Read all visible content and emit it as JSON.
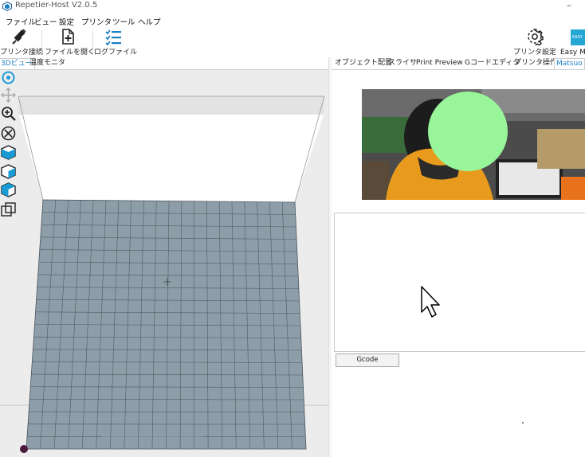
{
  "window": {
    "title": "Repetier-Host V2.0.5",
    "minimize_glyph": "–"
  },
  "menu": [
    "ファイル",
    "ビュー",
    "設定",
    "プリンタ",
    "ツール",
    "ヘルプ"
  ],
  "toolbar": {
    "connect_label": "プリンタ接続",
    "open_label": "ファイルを開く",
    "log_label": "ログファイル",
    "printer_settings_label": "プリンタ設定",
    "easy_mode_label": "Easy M",
    "easy_badge": "EASY"
  },
  "left_tabs": [
    "3Dビュー",
    "温度モニタ"
  ],
  "right_tabs": [
    "オブジェクト配置",
    "スライサ",
    "Print Preview",
    "Gコードエディタ",
    "プリンタ操作",
    "Matsuo"
  ],
  "gcode_button": "Gcode",
  "colors": {
    "accent": "#1a7fc4",
    "bed": "#8e9ea8",
    "green_circle": "#98f59a"
  },
  "icons": [
    "rotate-icon",
    "move-icon",
    "zoom-icon",
    "fit-icon",
    "cube-front-icon",
    "cube-side-icon",
    "cube-top-icon",
    "cube-wire-icon"
  ]
}
